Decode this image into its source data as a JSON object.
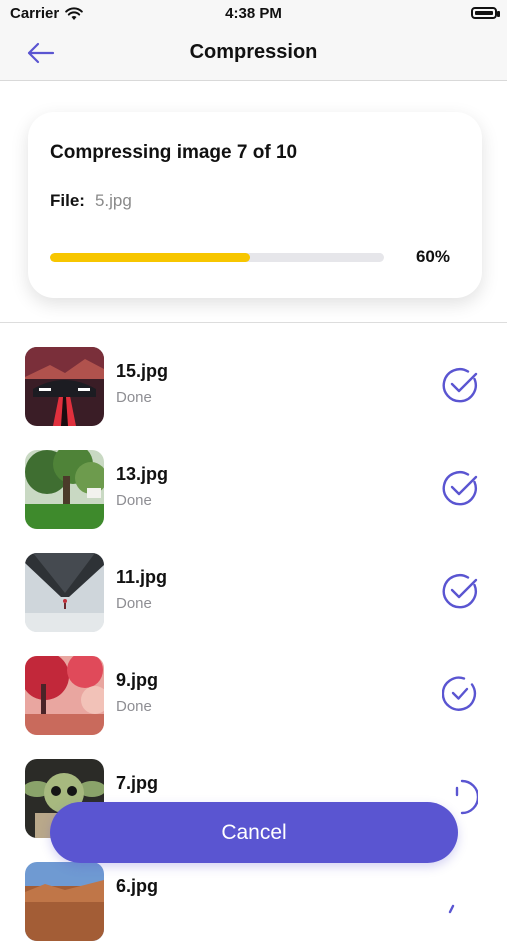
{
  "status_bar": {
    "carrier": "Carrier",
    "time": "4:38 PM"
  },
  "nav": {
    "title": "Compression",
    "back_icon": "arrow-left-icon"
  },
  "progress_card": {
    "title": "Compressing image 7 of 10",
    "file_label": "File:",
    "file_name": "5.jpg",
    "progress_fraction": 0.6,
    "progress_text": "60%",
    "progress_color": "#f7c600"
  },
  "items": [
    {
      "name": "15.jpg",
      "status": "Done",
      "state": "done",
      "thumb": "car"
    },
    {
      "name": "13.jpg",
      "status": "Done",
      "state": "done",
      "thumb": "tree"
    },
    {
      "name": "11.jpg",
      "status": "Done",
      "state": "done",
      "thumb": "mountain"
    },
    {
      "name": "9.jpg",
      "status": "Done",
      "state": "done",
      "thumb": "autumn"
    },
    {
      "name": "7.jpg",
      "status": "",
      "state": "in-progress",
      "thumb": "creature"
    },
    {
      "name": "6.jpg",
      "status": "",
      "state": "pending",
      "thumb": "desert"
    }
  ],
  "cancel_label": "Cancel",
  "colors": {
    "accent": "#5a55d1",
    "progress": "#f7c600"
  }
}
